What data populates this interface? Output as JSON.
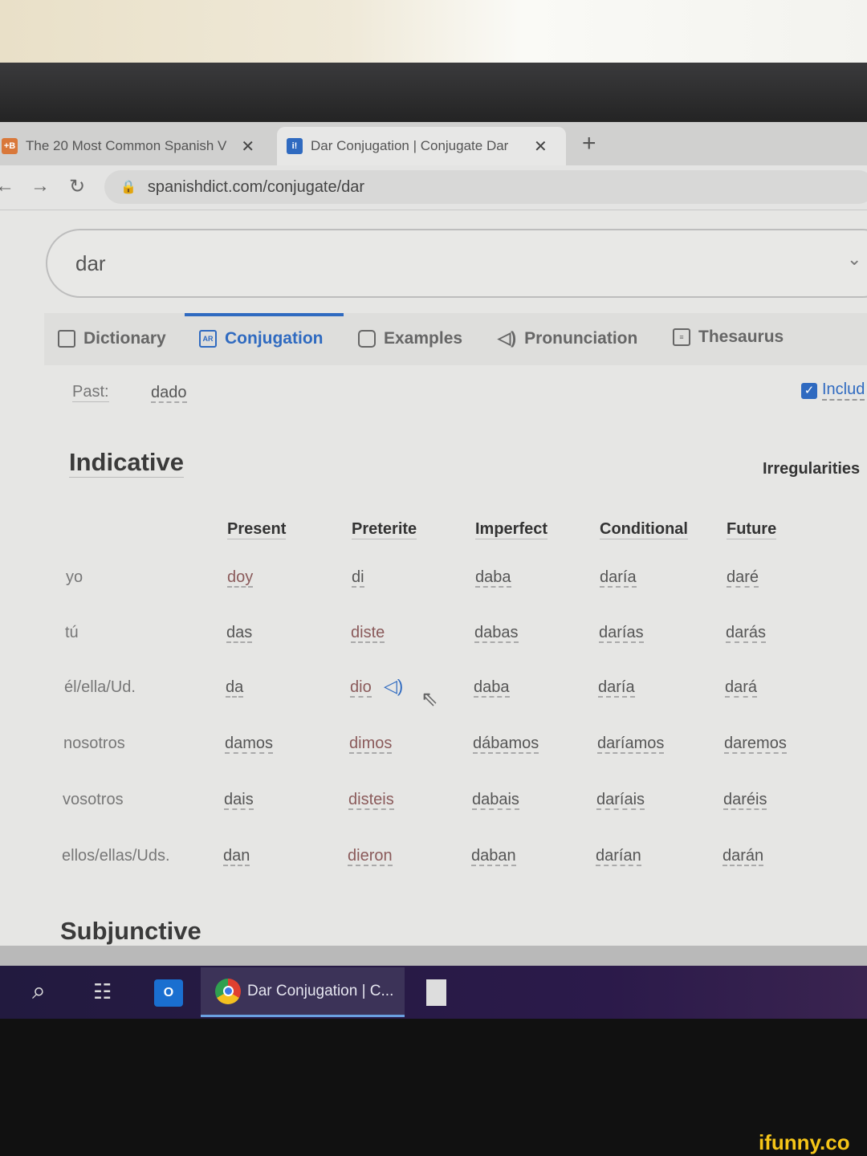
{
  "browser": {
    "tabs": [
      {
        "label": "The 20 Most Common Spanish V",
        "favicon": "+B"
      },
      {
        "label": "Dar Conjugation | Conjugate Dar",
        "favicon": "i!"
      }
    ],
    "new_tab": "+",
    "close": "✕",
    "url": "spanishdict.com/conjugate/dar"
  },
  "search": {
    "value": "dar"
  },
  "nav_tabs": [
    {
      "label": "Dictionary",
      "icon": "book-icon"
    },
    {
      "label": "Conjugation",
      "icon": "ar-icon"
    },
    {
      "label": "Examples",
      "icon": "chat-icon"
    },
    {
      "label": "Pronunciation",
      "icon": "speaker-icon"
    },
    {
      "label": "Thesaurus",
      "icon": "thesaurus-icon"
    }
  ],
  "past": {
    "label": "Past:",
    "value": "dado"
  },
  "include_label": "Includ",
  "indicative": {
    "title": "Indicative",
    "irregularities": "Irregularities",
    "columns": [
      "Present",
      "Preterite",
      "Imperfect",
      "Conditional",
      "Future"
    ],
    "rows": [
      {
        "pronoun": "yo",
        "forms": [
          "doy",
          "di",
          "daba",
          "daría",
          "daré"
        ]
      },
      {
        "pronoun": "tú",
        "forms": [
          "das",
          "diste",
          "dabas",
          "darías",
          "darás"
        ]
      },
      {
        "pronoun": "él/ella/Ud.",
        "forms": [
          "da",
          "dio",
          "daba",
          "daría",
          "dará"
        ]
      },
      {
        "pronoun": "nosotros",
        "forms": [
          "damos",
          "dimos",
          "dábamos",
          "daríamos",
          "daremos"
        ]
      },
      {
        "pronoun": "vosotros",
        "forms": [
          "dais",
          "disteis",
          "dabais",
          "daríais",
          "daréis"
        ]
      },
      {
        "pronoun": "ellos/ellas/Uds.",
        "forms": [
          "dan",
          "dieron",
          "daban",
          "darían",
          "darán"
        ]
      }
    ]
  },
  "subjunctive": {
    "title": "Subjunctive"
  },
  "taskbar": {
    "chrome_label": "Dar Conjugation | C..."
  },
  "watermark": "ifunny.co",
  "colors": {
    "accent": "#2f6ac0",
    "taskbar": "#2b1a4a"
  }
}
